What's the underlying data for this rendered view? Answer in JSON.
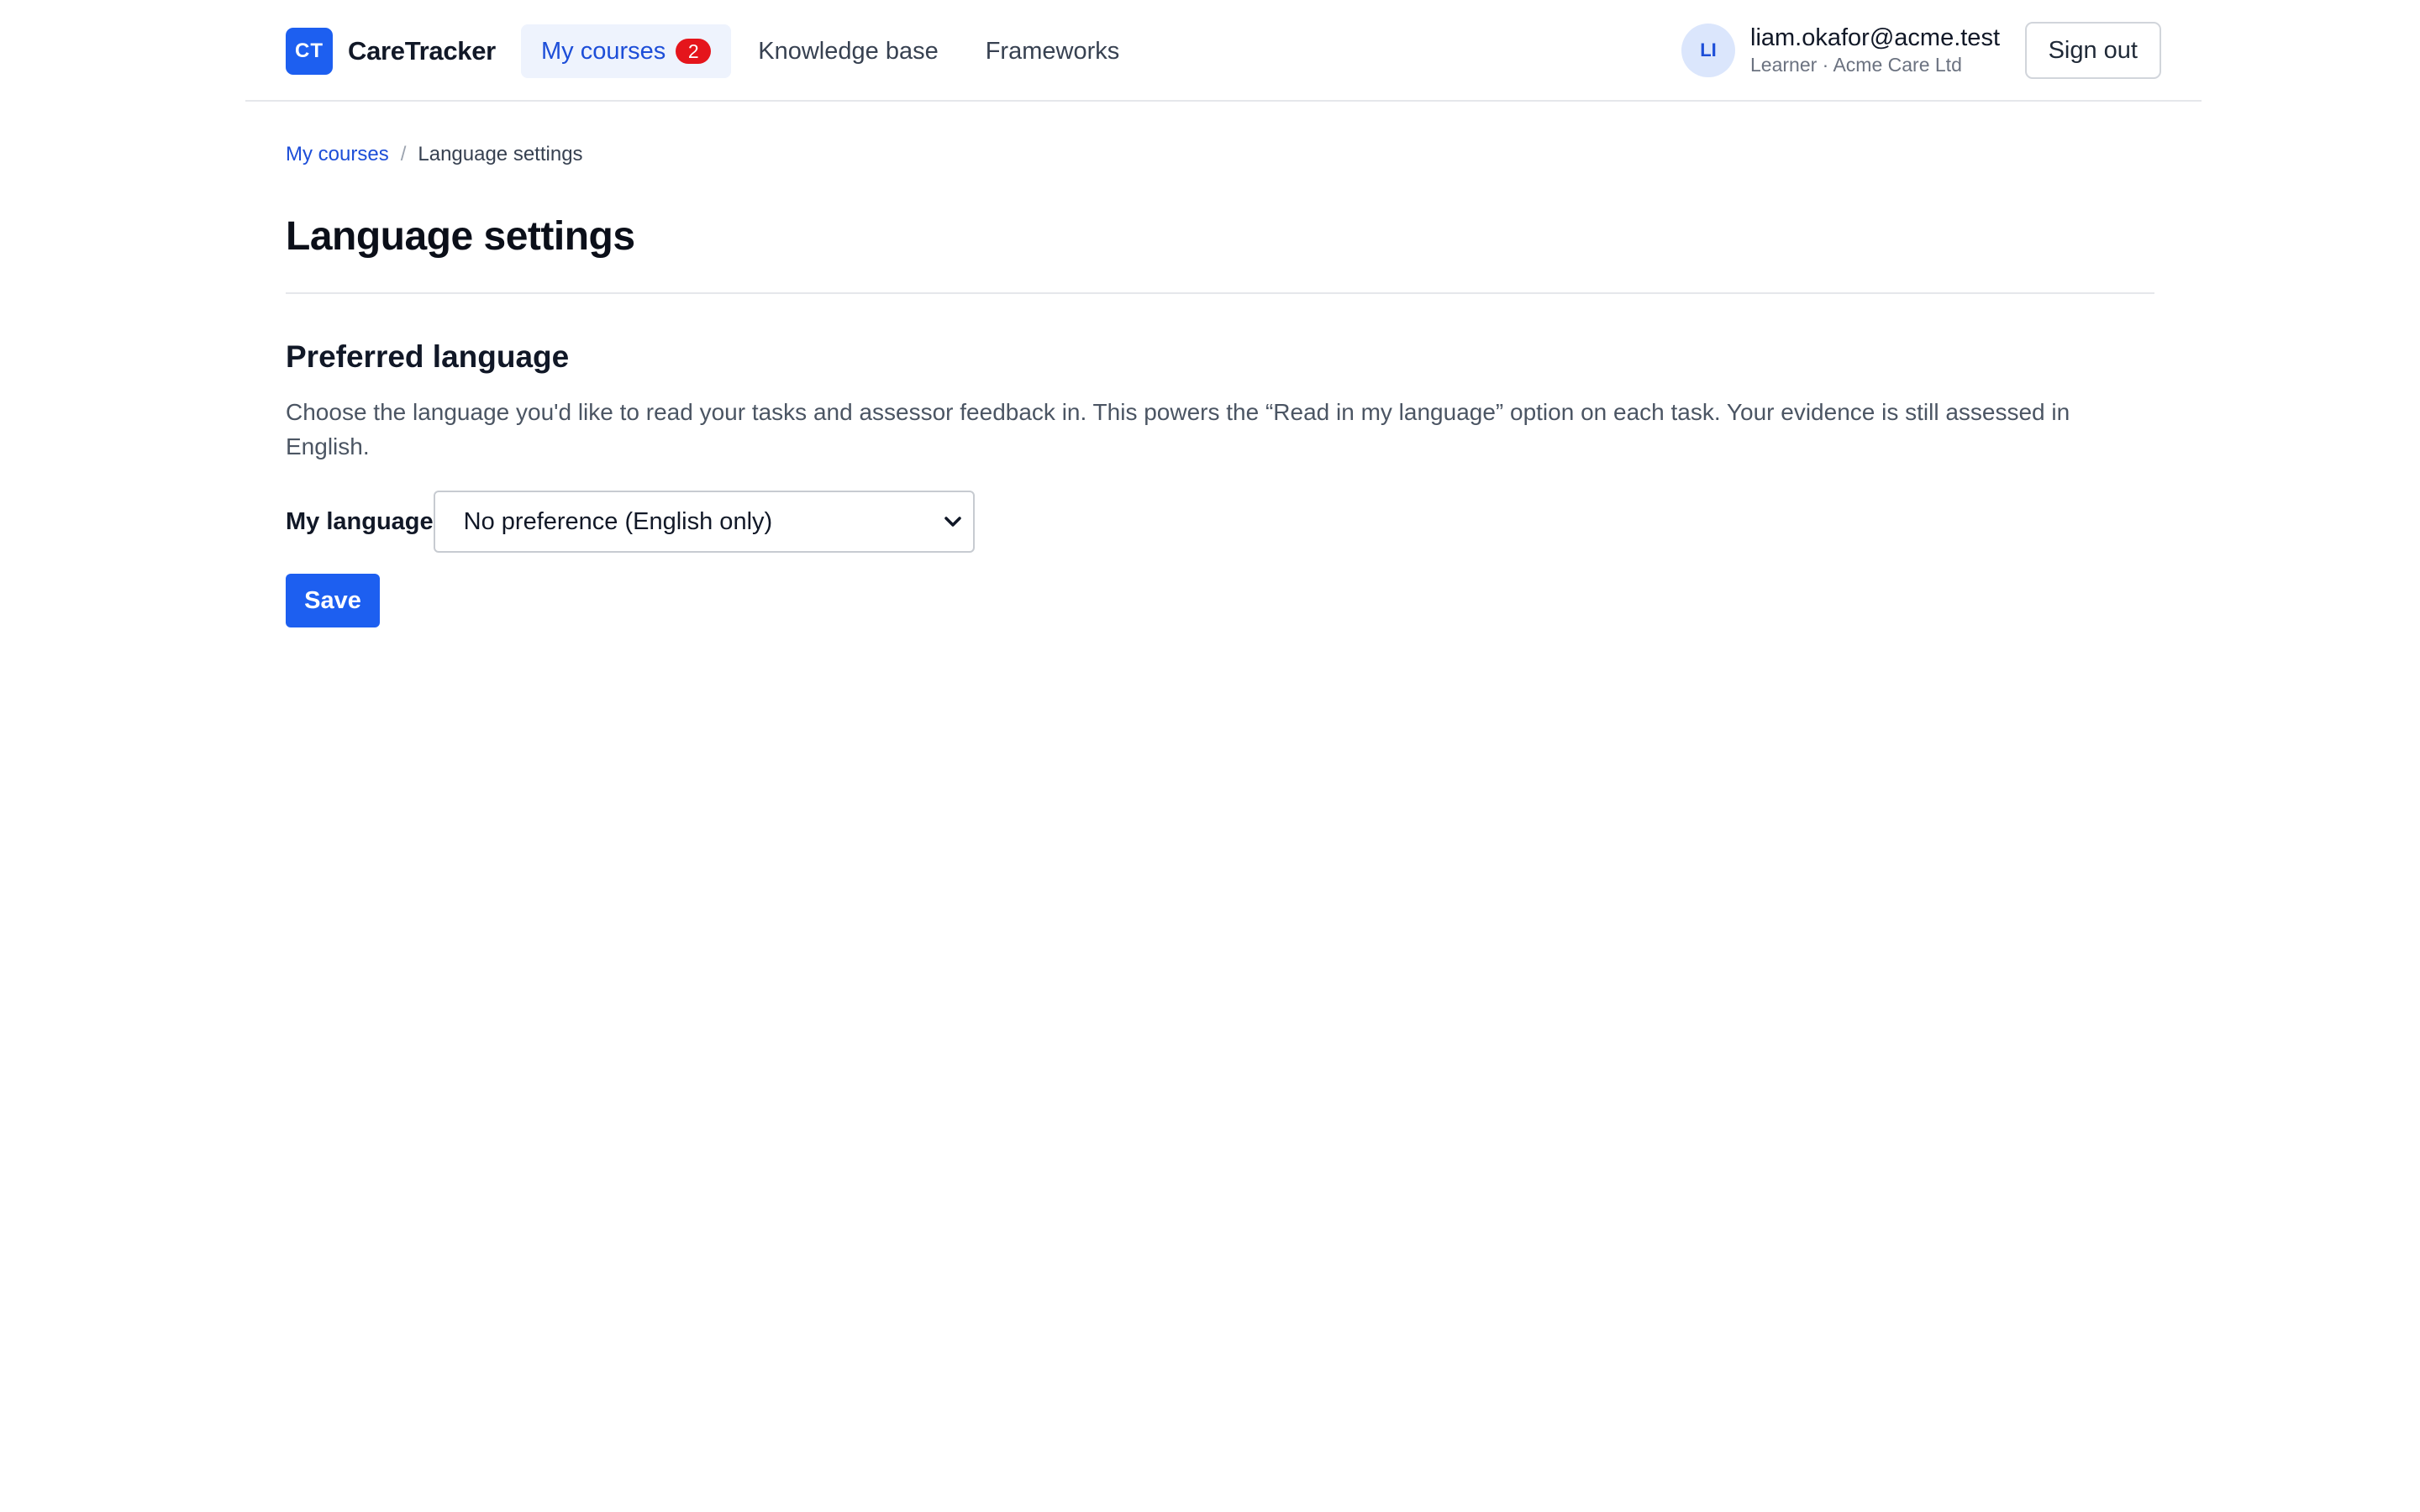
{
  "header": {
    "logo_text": "CT",
    "app_name": "CareTracker",
    "nav": [
      {
        "label": "My courses",
        "badge": "2",
        "active": true
      },
      {
        "label": "Knowledge base"
      },
      {
        "label": "Frameworks"
      }
    ],
    "user": {
      "initials": "LI",
      "email": "liam.okafor@acme.test",
      "role": "Learner · Acme Care Ltd"
    },
    "signout_label": "Sign out"
  },
  "breadcrumb": {
    "parent": "My courses",
    "separator": "/",
    "current": "Language settings"
  },
  "page": {
    "title": "Language settings",
    "section_title": "Preferred language",
    "description": "Choose the language you'd like to read your tasks and assessor feedback in. This powers the “Read in my language” option on each task. Your evidence is still assessed in English.",
    "field_label": "My language",
    "select_value": "No preference (English only)",
    "save_label": "Save"
  },
  "colors": {
    "primary": "#1d5ff0",
    "badge": "#e5151c",
    "link": "#1d4ed8"
  }
}
